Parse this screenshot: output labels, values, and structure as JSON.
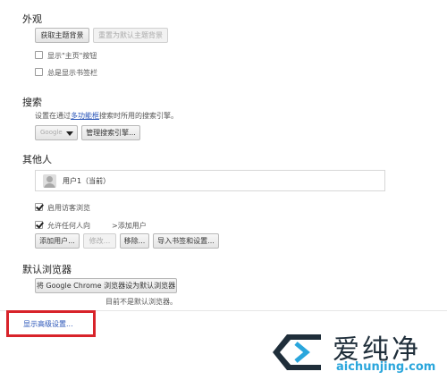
{
  "appearance": {
    "title": "外观",
    "get_theme_button": "获取主题背景",
    "reset_theme_button": "重置为默认主题背景",
    "show_home_label": "显示\"主页\"按钮",
    "show_home_checked": false,
    "show_bookmarks_label": "总是显示书签栏",
    "show_bookmarks_checked": false
  },
  "search": {
    "title": "搜索",
    "desc_prefix": "设置在通过",
    "desc_link": "多功能框",
    "desc_suffix": "搜索时所用的搜索引擎。",
    "engine_selected": "Google",
    "manage_button": "管理搜索引擎..."
  },
  "people": {
    "title": "其他人",
    "user_name": "用户1（当前）",
    "guest_label": "启用访客浏览",
    "guest_checked": true,
    "allow_add_label": "允许任何人向",
    "allow_add_suffix": ">添加用户",
    "allow_add_checked": true,
    "add_user_button": "添加用户...",
    "edit_button": "修改...",
    "remove_button": "移除...",
    "import_button": "导入书签和设置..."
  },
  "default_browser": {
    "title": "默认浏览器",
    "set_default_button": "将 Google Chrome 浏览器设为默认浏览器",
    "status_text": "目前不是默认浏览器。"
  },
  "advanced": {
    "link_text": "显示高级设置..."
  },
  "watermark": {
    "name_cn": "爱纯净",
    "name_en": "aichunjing.com",
    "brand_color": "#2aa6dc"
  },
  "colors": {
    "highlight": "#d8232a",
    "link": "#2a55b8"
  }
}
